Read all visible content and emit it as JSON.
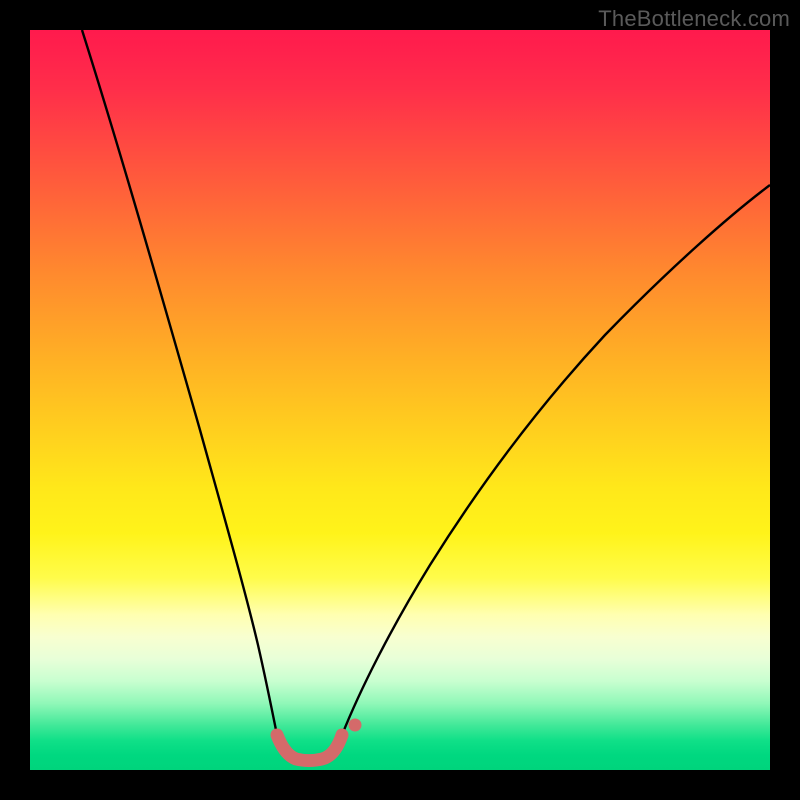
{
  "watermark": "TheBottleneck.com",
  "chart_data": {
    "type": "line",
    "title": "",
    "xlabel": "",
    "ylabel": "",
    "xlim": [
      0,
      100
    ],
    "ylim": [
      0,
      100
    ],
    "grid": false,
    "legend": false,
    "series": [
      {
        "name": "curve-left",
        "color": "#000000",
        "x": [
          7,
          10,
          13,
          16,
          19,
          22,
          24,
          26,
          28,
          30,
          31.5
        ],
        "y": [
          100,
          87,
          74,
          61,
          49,
          38,
          29,
          21,
          14,
          8,
          4
        ]
      },
      {
        "name": "curve-right",
        "color": "#000000",
        "x": [
          40,
          43,
          47,
          52,
          58,
          65,
          73,
          82,
          92,
          100
        ],
        "y": [
          4,
          8,
          14,
          22,
          31,
          41,
          51,
          61,
          70,
          77
        ]
      },
      {
        "name": "highlight-band",
        "color": "#d46a6a",
        "x": [
          31.5,
          33,
          34.5,
          36,
          37.5,
          39,
          40
        ],
        "y": [
          4,
          2,
          1.3,
          1.3,
          1.5,
          2.5,
          4
        ]
      },
      {
        "name": "highlight-dot",
        "color": "#d46a6a",
        "x": [
          41.5
        ],
        "y": [
          5.5
        ]
      }
    ],
    "background_gradient": {
      "top": "#ff1a4d",
      "mid": "#ffe81a",
      "bottom": "#00d880"
    }
  }
}
